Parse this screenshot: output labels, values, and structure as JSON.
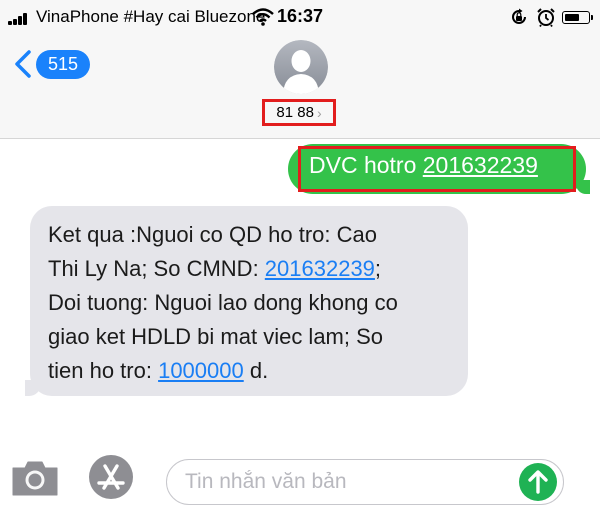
{
  "status_bar": {
    "carrier": "VinaPhone #Hay cai Bluezone",
    "time": "16:37",
    "battery_level": 0.68
  },
  "header": {
    "back_count": "515",
    "contact_name": "81 88",
    "contact_chevron": "›"
  },
  "messages": {
    "sent": {
      "prefix": "DVC hotro ",
      "link": "201632239"
    },
    "received": {
      "line1": "Ket qua :Nguoi co QD ho tro: Cao",
      "line2a": "Thi Ly Na; So CMND: ",
      "line2_link": "201632239",
      "line2b": ";",
      "line3": "Doi tuong: Nguoi lao dong khong co",
      "line4": "giao ket HDLD bi mat viec lam; So",
      "line5a": "tien  ho tro: ",
      "line5_link": "1000000",
      "line5b": " d."
    }
  },
  "input_bar": {
    "placeholder": "Tin nhắn văn bản",
    "icons": [
      "camera-icon",
      "app-store-icon",
      "send-arrow-icon"
    ]
  },
  "colors": {
    "sent_bubble": "#34c24a",
    "received_bubble": "#e5e5ea",
    "link": "#1a7ef4",
    "highlight_box": "#e21d1d",
    "badge": "#1a82fb",
    "send_button": "#1fb254"
  }
}
